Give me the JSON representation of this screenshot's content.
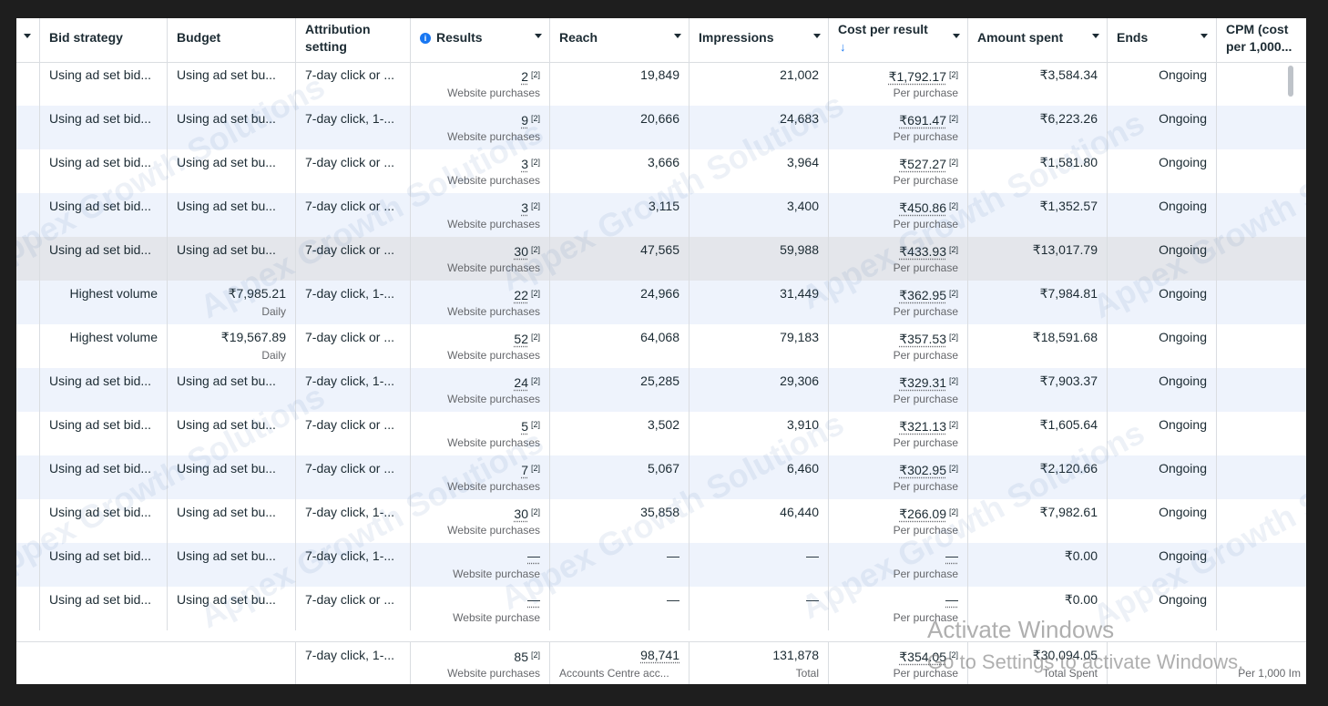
{
  "columns": [
    {
      "key": "sel",
      "label": ""
    },
    {
      "key": "bid",
      "label": "Bid strategy"
    },
    {
      "key": "budget",
      "label": "Budget"
    },
    {
      "key": "attr",
      "label": "Attribution setting"
    },
    {
      "key": "results",
      "label": "Results"
    },
    {
      "key": "reach",
      "label": "Reach"
    },
    {
      "key": "impr",
      "label": "Impressions"
    },
    {
      "key": "cpr",
      "label": "Cost per result"
    },
    {
      "key": "spent",
      "label": "Amount spent"
    },
    {
      "key": "ends",
      "label": "Ends"
    },
    {
      "key": "cpm",
      "label": "CPM (cost per 1,000..."
    }
  ],
  "sort_indicator": "↓",
  "rows": [
    {
      "bid": "Using ad set bid...",
      "budget": "Using ad set bu...",
      "budget_sub": "",
      "attr": "7-day click or ...",
      "results": "2",
      "results_sub": "Website purchases",
      "reach": "19,849",
      "impr": "21,002",
      "cpr": "₹1,792.17",
      "cpr_sub": "Per purchase",
      "spent": "₹3,584.34",
      "ends": "Ongoing"
    },
    {
      "bid": "Using ad set bid...",
      "budget": "Using ad set bu...",
      "budget_sub": "",
      "attr": "7-day click, 1-...",
      "results": "9",
      "results_sub": "Website purchases",
      "reach": "20,666",
      "impr": "24,683",
      "cpr": "₹691.47",
      "cpr_sub": "Per purchase",
      "spent": "₹6,223.26",
      "ends": "Ongoing"
    },
    {
      "bid": "Using ad set bid...",
      "budget": "Using ad set bu...",
      "budget_sub": "",
      "attr": "7-day click or ...",
      "results": "3",
      "results_sub": "Website purchases",
      "reach": "3,666",
      "impr": "3,964",
      "cpr": "₹527.27",
      "cpr_sub": "Per purchase",
      "spent": "₹1,581.80",
      "ends": "Ongoing"
    },
    {
      "bid": "Using ad set bid...",
      "budget": "Using ad set bu...",
      "budget_sub": "",
      "attr": "7-day click or ...",
      "results": "3",
      "results_sub": "Website purchases",
      "reach": "3,115",
      "impr": "3,400",
      "cpr": "₹450.86",
      "cpr_sub": "Per purchase",
      "spent": "₹1,352.57",
      "ends": "Ongoing"
    },
    {
      "bid": "Using ad set bid...",
      "budget": "Using ad set bu...",
      "budget_sub": "",
      "attr": "7-day click or ...",
      "results": "30",
      "results_sub": "Website purchases",
      "reach": "47,565",
      "impr": "59,988",
      "cpr": "₹433.93",
      "cpr_sub": "Per purchase",
      "spent": "₹13,017.79",
      "ends": "Ongoing"
    },
    {
      "bid": "Highest volume",
      "budget": "₹7,985.21",
      "budget_sub": "Daily",
      "attr": "7-day click, 1-...",
      "results": "22",
      "results_sub": "Website purchases",
      "reach": "24,966",
      "impr": "31,449",
      "cpr": "₹362.95",
      "cpr_sub": "Per purchase",
      "spent": "₹7,984.81",
      "ends": "Ongoing"
    },
    {
      "bid": "Highest volume",
      "budget": "₹19,567.89",
      "budget_sub": "Daily",
      "attr": "7-day click or ...",
      "results": "52",
      "results_sub": "Website purchases",
      "reach": "64,068",
      "impr": "79,183",
      "cpr": "₹357.53",
      "cpr_sub": "Per purchase",
      "spent": "₹18,591.68",
      "ends": "Ongoing"
    },
    {
      "bid": "Using ad set bid...",
      "budget": "Using ad set bu...",
      "budget_sub": "",
      "attr": "7-day click, 1-...",
      "results": "24",
      "results_sub": "Website purchases",
      "reach": "25,285",
      "impr": "29,306",
      "cpr": "₹329.31",
      "cpr_sub": "Per purchase",
      "spent": "₹7,903.37",
      "ends": "Ongoing"
    },
    {
      "bid": "Using ad set bid...",
      "budget": "Using ad set bu...",
      "budget_sub": "",
      "attr": "7-day click or ...",
      "results": "5",
      "results_sub": "Website purchases",
      "reach": "3,502",
      "impr": "3,910",
      "cpr": "₹321.13",
      "cpr_sub": "Per purchase",
      "spent": "₹1,605.64",
      "ends": "Ongoing"
    },
    {
      "bid": "Using ad set bid...",
      "budget": "Using ad set bu...",
      "budget_sub": "",
      "attr": "7-day click or ...",
      "results": "7",
      "results_sub": "Website purchases",
      "reach": "5,067",
      "impr": "6,460",
      "cpr": "₹302.95",
      "cpr_sub": "Per purchase",
      "spent": "₹2,120.66",
      "ends": "Ongoing"
    },
    {
      "bid": "Using ad set bid...",
      "budget": "Using ad set bu...",
      "budget_sub": "",
      "attr": "7-day click, 1-...",
      "results": "30",
      "results_sub": "Website purchases",
      "reach": "35,858",
      "impr": "46,440",
      "cpr": "₹266.09",
      "cpr_sub": "Per purchase",
      "spent": "₹7,982.61",
      "ends": "Ongoing"
    },
    {
      "bid": "Using ad set bid...",
      "budget": "Using ad set bu...",
      "budget_sub": "",
      "attr": "7-day click, 1-...",
      "results": "—",
      "results_sub": "Website purchase",
      "reach": "—",
      "impr": "—",
      "cpr": "—",
      "cpr_sub": "Per purchase",
      "spent": "₹0.00",
      "ends": "Ongoing"
    },
    {
      "bid": "Using ad set bid...",
      "budget": "Using ad set bu...",
      "budget_sub": "",
      "attr": "7-day click or ...",
      "results": "—",
      "results_sub": "Website purchase",
      "reach": "—",
      "impr": "—",
      "cpr": "—",
      "cpr_sub": "Per purchase",
      "spent": "₹0.00",
      "ends": "Ongoing"
    }
  ],
  "totals": {
    "attr": "7-day click, 1-...",
    "results": "85",
    "results_sub": "Website purchases",
    "reach": "98,741",
    "reach_sub": "Accounts Centre acc...",
    "impr": "131,878",
    "impr_sub": "Total",
    "cpr": "₹354.05",
    "cpr_sub": "Per purchase",
    "spent": "₹30,094.05",
    "spent_sub": "Total Spent",
    "cpm_sub": "Per 1,000 Im"
  },
  "footnote_marker": "[2]",
  "watermark": "Appex Growth Solutions",
  "os_notice": {
    "title": "Activate Windows",
    "subtitle": "Go to Settings to activate Windows."
  },
  "colors": {
    "accent": "#1877f2",
    "row_alt": "#eef3fc",
    "row_highlight": "#e4e6eb"
  }
}
